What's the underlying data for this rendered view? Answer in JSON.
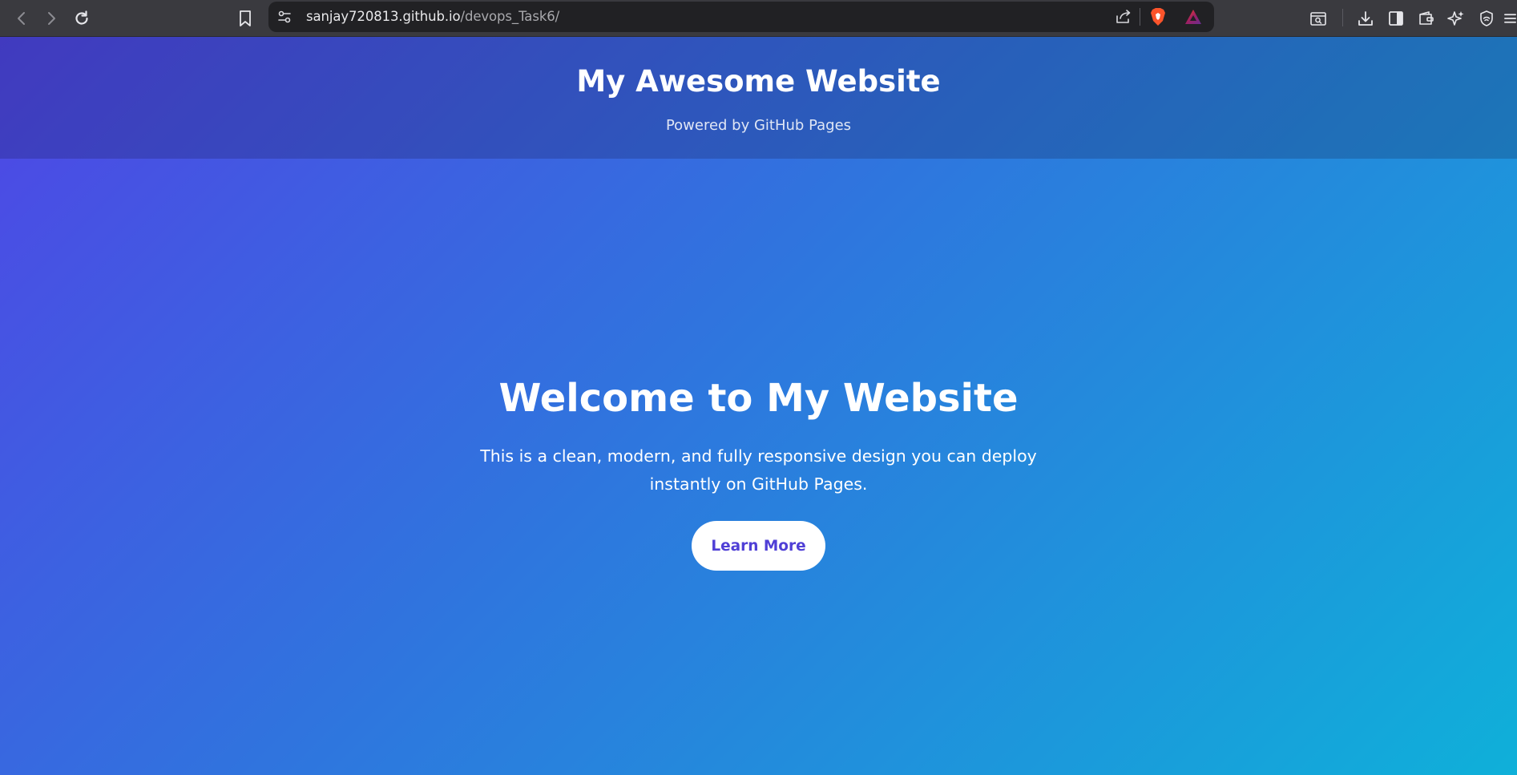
{
  "browser": {
    "url_host": "sanjay720813.github.io",
    "url_path": "/devops_Task6/",
    "icons": {
      "back": "back-arrow-icon",
      "forward": "forward-arrow-icon",
      "reload": "reload-icon",
      "bookmark": "bookmark-icon",
      "site_settings": "site-settings-icon",
      "share": "share-icon",
      "brave_shields": "brave-shields-icon",
      "brave_rewards": "brave-rewards-icon",
      "tab_search": "tab-search-icon",
      "downloads": "download-icon",
      "sidebar": "sidebar-icon",
      "wallet": "wallet-icon",
      "leo_ai": "leo-ai-icon",
      "vpn": "vpn-shield-icon",
      "menu": "menu-icon"
    },
    "colors": {
      "toolbar": "#3a3a3f",
      "address_bar": "#212124",
      "brave_orange": "#fb542b"
    }
  },
  "header": {
    "title": "My Awesome Website",
    "subtitle": "Powered by GitHub Pages"
  },
  "hero": {
    "title": "Welcome to My Website",
    "text": "This is a clean, modern, and fully responsive design you can deploy instantly on GitHub Pages.",
    "button_label": "Learn More"
  },
  "colors": {
    "gradient_start": "#4f46e5",
    "gradient_end": "#0fb0d9",
    "button_text": "#4f3fd6"
  }
}
